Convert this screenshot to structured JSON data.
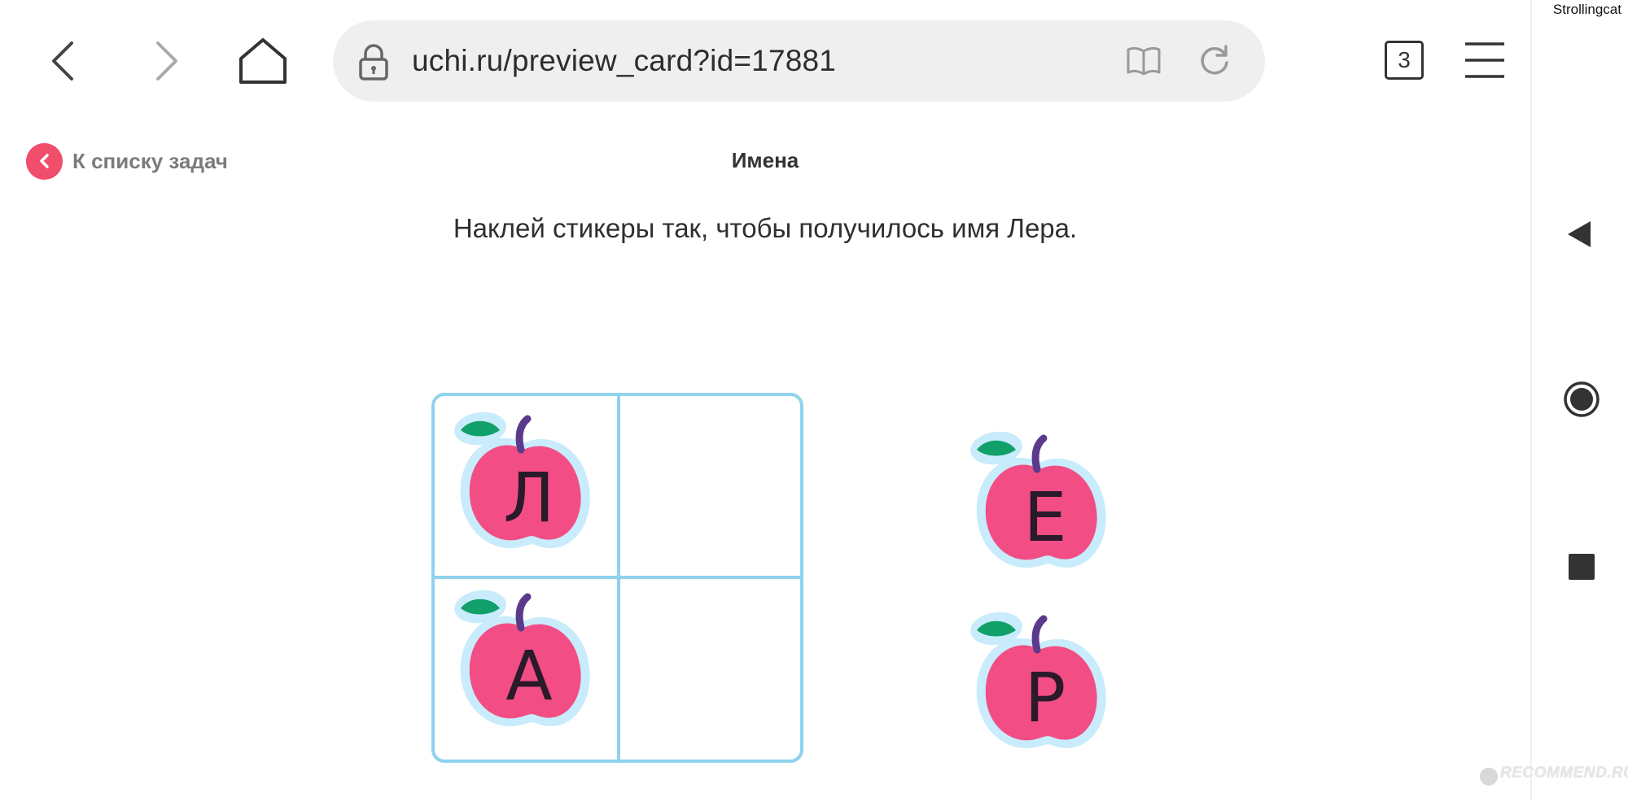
{
  "browser": {
    "url": "uchi.ru/preview_card?id=17881",
    "tab_count": "3"
  },
  "overlay": {
    "username": "Strollingcat",
    "watermark": "RECOMMEND.RU"
  },
  "task": {
    "back_link_label": "К списку задач",
    "title": "Имена",
    "instruction": "Наклей стикеры так, чтобы получилось имя Лера."
  },
  "board": {
    "placed_stickers": [
      {
        "letter": "Л"
      },
      {
        "letter": "А"
      }
    ]
  },
  "available_stickers": [
    {
      "letter": "Е"
    },
    {
      "letter": "Р"
    }
  ],
  "colors": {
    "accent": "#f04e6b",
    "apple": "#f24d84",
    "apple_halo": "#c8ecfb",
    "leaf": "#12a06a",
    "stem": "#5b3a8c",
    "board_border": "#8fd3ee"
  }
}
